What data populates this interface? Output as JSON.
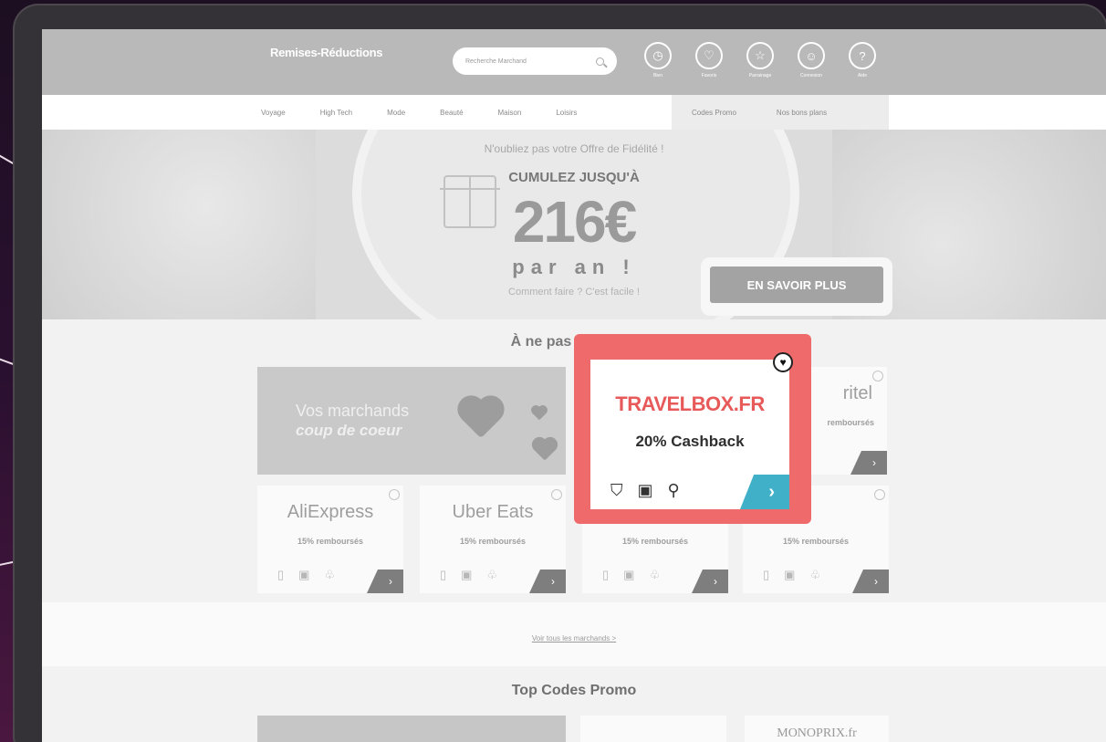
{
  "header": {
    "logo": "Remises-Réductions",
    "logo_subtitle": "",
    "search_placeholder": "Recherche Marchand",
    "icons": [
      {
        "icon": "clock-icon",
        "label": "Bien"
      },
      {
        "icon": "heart-icon",
        "label": "Favoris"
      },
      {
        "icon": "star-icon",
        "label": "Parrainage"
      },
      {
        "icon": "user-icon",
        "label": "Connexion"
      },
      {
        "icon": "help-icon",
        "label": "Aide"
      }
    ]
  },
  "nav": {
    "items": [
      "Voyage",
      "High Tech",
      "Mode",
      "Beauté",
      "Maison",
      "Loisirs"
    ],
    "promo_items": [
      "Codes Promo",
      "Nos bons plans"
    ]
  },
  "hero": {
    "line1": "N'oubliez pas votre Offre de Fidélité !",
    "line2": "CUMULEZ JUSQU'À",
    "amount": "216€",
    "line3": "par an !",
    "line4": "Comment faire ? C'est facile !",
    "cta": "EN SAVOIR PLUS"
  },
  "section": {
    "title": "À ne pas manquer",
    "feature_line1": "Vos marchands",
    "feature_line2": "coup de coeur",
    "cards_top": [
      {
        "name": "ritel",
        "cash": "remboursés"
      }
    ],
    "cards_bottom": [
      {
        "name": "AliExpress",
        "cash": "15% remboursés"
      },
      {
        "name": "Uber Eats",
        "cash": "15% remboursés"
      },
      {
        "name": "",
        "cash": "15% remboursés"
      },
      {
        "name": "",
        "cash": "15% remboursés"
      }
    ],
    "more_link": "Voir tous les marchands >"
  },
  "top_codes": {
    "title": "Top Codes Promo",
    "card3": "MONOPRIX.fr"
  },
  "highlight": {
    "brand": "TRAVELBOX.FR",
    "cashback": "20% Cashback",
    "go_label": "›",
    "accent_color": "#ef6b6b",
    "go_color": "#3fb0c7"
  }
}
